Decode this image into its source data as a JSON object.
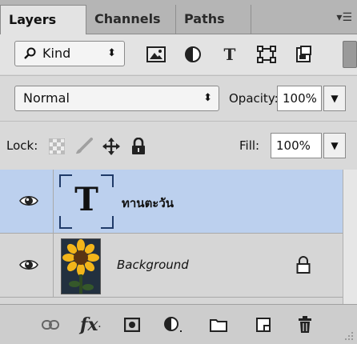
{
  "tabs": [
    {
      "label": "Layers",
      "active": true
    },
    {
      "label": "Channels",
      "active": false
    },
    {
      "label": "Paths",
      "active": false
    }
  ],
  "panel_menu_icon": "panel-menu-icon",
  "filter": {
    "kind_label": "Kind",
    "icons": [
      "pixel-layer-filter-icon",
      "adjustment-layer-filter-icon",
      "type-layer-filter-icon",
      "shape-layer-filter-icon",
      "smart-object-filter-icon"
    ],
    "type_glyph": "T"
  },
  "blend": {
    "mode": "Normal",
    "opacity_label": "Opacity:",
    "opacity_value": "100%"
  },
  "lock": {
    "label": "Lock:",
    "fill_label": "Fill:",
    "fill_value": "100%"
  },
  "layers": [
    {
      "name": "ทานตะวัน",
      "type": "text",
      "thumb_glyph": "T",
      "selected": true,
      "visible": true
    },
    {
      "name": "Background",
      "type": "image",
      "selected": false,
      "visible": true,
      "locked": true
    }
  ],
  "footer_icons": [
    "link-layers-icon",
    "fx-icon",
    "layer-mask-icon",
    "adjustment-layer-icon",
    "new-group-icon",
    "new-layer-icon",
    "delete-layer-icon"
  ],
  "footer": {
    "fx_label": "fx"
  },
  "colors": {
    "selected_row": "#bcd0ee",
    "panel_bg": "#d6d6d6"
  }
}
